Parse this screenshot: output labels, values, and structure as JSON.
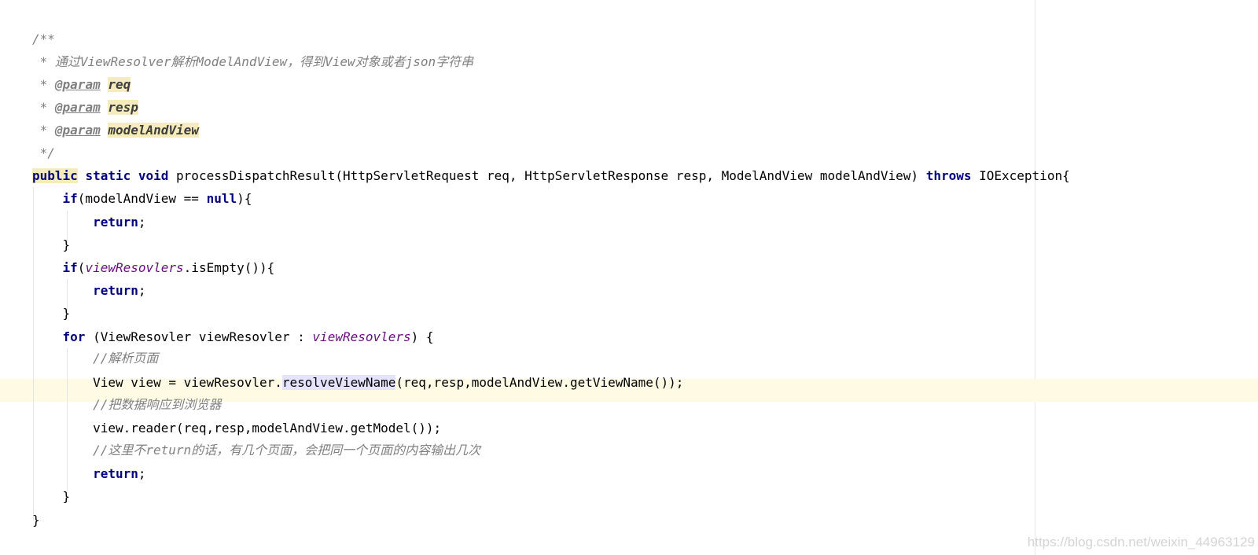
{
  "editor": {
    "javadoc": {
      "open": "/**",
      "desc_prefix": " * ",
      "description": "通过ViewResolver解析ModelAndView，得到View对象或者json字符串",
      "params": [
        {
          "prefix": " * ",
          "tag": "@param",
          "name": "req"
        },
        {
          "prefix": " * ",
          "tag": "@param",
          "name": "resp"
        },
        {
          "prefix": " * ",
          "tag": "@param",
          "name": "modelAndView"
        }
      ],
      "close": " */"
    },
    "signature": {
      "kw_public": "public",
      "kw_static": "static",
      "kw_void": "void",
      "text": " processDispatchResult(HttpServletRequest req, HttpServletResponse resp, ModelAndView modelAndView) ",
      "kw_throws": "throws",
      "tail": " IOException{"
    },
    "block1": {
      "kw_if": "if",
      "cond": "(modelAndView == ",
      "kw_null": "null",
      "end": "){",
      "kw_return": "return",
      "semi": ";",
      "close": "}"
    },
    "block2": {
      "kw_if": "if",
      "open": "(",
      "field": "viewResovlers",
      "rest": ".isEmpty()){",
      "kw_return": "return",
      "semi": ";",
      "close": "}"
    },
    "loop": {
      "kw_for": "for",
      "head": " (ViewResovler viewResovler : ",
      "field": "viewResovlers",
      "end": ") {",
      "comment1": "//解析页面",
      "stmt1_pre": "View view = viewResovler.",
      "stmt1_method": "resolveViewName",
      "stmt1_post": "(req,resp,modelAndView.getViewName());",
      "comment2": "//把数据响应到浏览器",
      "stmt2": "view.reader(req,resp,modelAndView.getModel());",
      "comment3": "//这里不return的话，有几个页面，会把同一个页面的内容输出几次",
      "kw_return": "return",
      "semi": ";",
      "close": "}"
    },
    "method_close": "}"
  },
  "watermark": "https://blog.csdn.net/weixin_44963129",
  "colors": {
    "keyword": "#000080",
    "comment": "#808080",
    "field": "#660e7a",
    "caret_row": "#fffae3",
    "param_highlight": "#f6ebbc",
    "method_highlight": "#e4e4ff"
  }
}
